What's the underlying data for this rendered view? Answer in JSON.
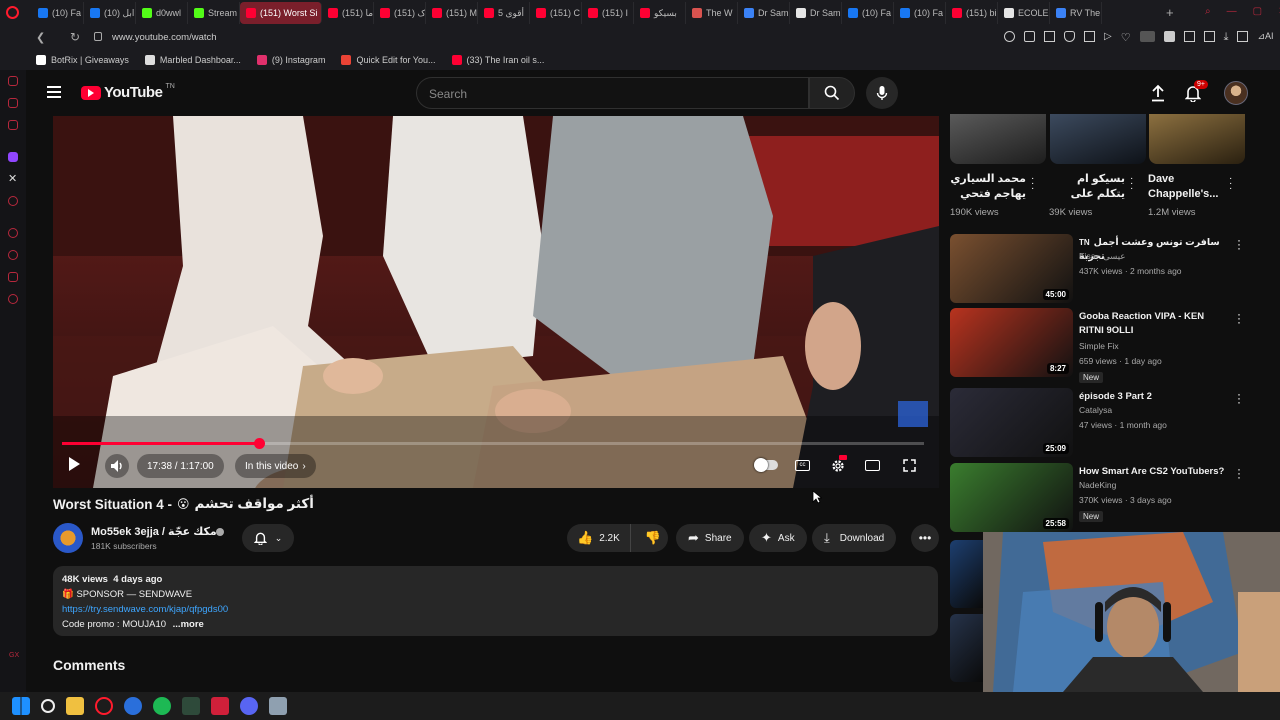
{
  "browser": {
    "tabs": [
      {
        "label": "(10) Fa",
        "color": "#1877f2"
      },
      {
        "label": "(10) ابل",
        "color": "#1877f2"
      },
      {
        "label": "d0wwl",
        "color": "#53fc18"
      },
      {
        "label": "Stream",
        "color": "#53fc18"
      },
      {
        "label": "(151) Worst Si",
        "color": "#ff0033",
        "active": true
      },
      {
        "label": "(151) ما",
        "color": "#ff0033"
      },
      {
        "label": "(151) ک",
        "color": "#ff0033"
      },
      {
        "label": "(151) M",
        "color": "#ff0033"
      },
      {
        "label": "أقوى 5",
        "color": "#ff0033"
      },
      {
        "label": "(151) C",
        "color": "#ff0033"
      },
      {
        "label": "(151) I",
        "color": "#ff0033"
      },
      {
        "label": "بسيكو",
        "color": "#ff0033"
      },
      {
        "label": "The W",
        "color": "#d9534f"
      },
      {
        "label": "Dr Sam",
        "color": "#3b82f6"
      },
      {
        "label": "Dr Sam",
        "color": "#e5e5e5"
      },
      {
        "label": "(10) Fa",
        "color": "#1877f2"
      },
      {
        "label": "(10) Fa",
        "color": "#1877f2"
      },
      {
        "label": "(151) bi",
        "color": "#ff0033"
      },
      {
        "label": "ECOLE",
        "color": "#e5e5e5"
      },
      {
        "label": "RV The",
        "color": "#3b82f6"
      }
    ],
    "url": "www.youtube.com/watch",
    "bookmarks": [
      {
        "label": "BotRix | Giveaways",
        "color": "#fff"
      },
      {
        "label": "Marbled Dashboar...",
        "color": "#ddd"
      },
      {
        "label": "(9) Instagram",
        "color": "#e1306c"
      },
      {
        "label": "Quick Edit for You...",
        "color": "#ea4335"
      },
      {
        "label": "(33) The Iran oil s...",
        "color": "#ff0033"
      }
    ]
  },
  "header": {
    "logo_text": "YouTube",
    "region": "TN",
    "search_placeholder": "Search",
    "notif_badge": "9+"
  },
  "player": {
    "time": "17:38 / 1:17:00",
    "in_this_video": "In this video",
    "progress": 0.229
  },
  "video": {
    "title_prefix": "Worst Situation 4 -",
    "title_emoji": "😮",
    "title_arabic": "أكثر مواقف تحشم",
    "channel_name": "Mo55ek 3ejja / مكك عجّة",
    "subscribers": "181K subscribers",
    "likes": "2.2K",
    "share": "Share",
    "ask": "Ask",
    "download": "Download",
    "views_date": "48K views  4 days ago",
    "desc_line1": "🎁 SPONSOR — SENDWAVE",
    "desc_link": "https://try.sendwave.com/kjap/qfpgds00",
    "desc_line3": "Code promo : MOUJA10",
    "more": "...more",
    "comments": "Comments"
  },
  "shorts": [
    {
      "title": "محمد السياري يهاجم فتحي ...",
      "views": "190K views"
    },
    {
      "title": "بسيكو ام يتكلم على سيطا و يوجه له ...",
      "views": "39K views"
    },
    {
      "title": "Dave Chappelle's...",
      "views": "1.2M views"
    }
  ],
  "recommendations": [
    {
      "title": "سافرت تونس وعشت أجمل تجربة",
      "title_prefix": "TN",
      "channel": "Eisa - عيسى",
      "meta": "437K views · 2 months ago",
      "duration": "45:00",
      "thumb_color": "#7a5030"
    },
    {
      "title": "Gooba Reaction VIPA - KEN RITNI 9OLLI",
      "channel": "Simple Fix",
      "meta": "659 views · 1 day ago",
      "badge": "New",
      "duration": "8:27",
      "thumb_color": "#b8331f"
    },
    {
      "title": "épisode 3 Part 2",
      "channel": "Catalysa",
      "meta": "47 views · 1 month ago",
      "duration": "25:09",
      "thumb_color": "#2b2b38"
    },
    {
      "title": "How Smart Are CS2 YouTubers?",
      "channel": "NadeKing",
      "meta": "370K views · 3 days ago",
      "badge": "New",
      "duration": "25:58",
      "thumb_color": "#3a7d2e"
    }
  ],
  "colors": {
    "accent": "#ff0033",
    "link": "#3ea6ff",
    "bg": "#0f0f0f"
  }
}
